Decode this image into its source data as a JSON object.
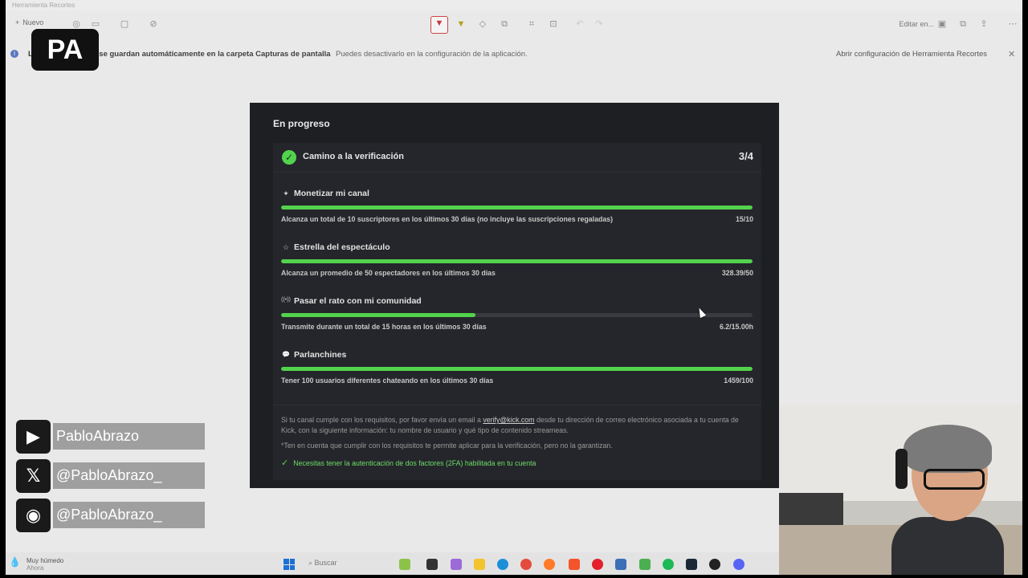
{
  "window": {
    "title": "Herramienta Recortes",
    "new_label": "Nuevo",
    "edit_in_label": "Editar en..."
  },
  "infobar": {
    "message_prefix": "L",
    "message": "alla se guardan automáticamente en la carpeta Capturas de pantalla",
    "sub": "Puedes desactivarlo en la configuración de la aplicación.",
    "link": "Abrir configuración de Herramienta Recortes",
    "close": "✕"
  },
  "logo": {
    "text": "PA"
  },
  "panel": {
    "title": "En progreso",
    "card_title": "Camino a la verificación",
    "card_count": "3/4",
    "requirements": [
      {
        "icon": "✦",
        "title": "Monetizar mi canal",
        "desc": "Alcanza un total de 10 suscriptores en los últimos 30 días (no incluye las suscripciones regaladas)",
        "value": "15/10",
        "progress": 1.0
      },
      {
        "icon": "☆",
        "title": "Estrella del espectáculo",
        "desc": "Alcanza un promedio de 50 espectadores en los últimos 30 días",
        "value": "328.39/50",
        "progress": 1.0
      },
      {
        "icon": "((•))",
        "title": "Pasar el rato con mi comunidad",
        "desc": "Transmite durante un total de 15 horas en los últimos 30 días",
        "value": "6.2/15.00h",
        "progress": 0.413
      },
      {
        "icon": "💬",
        "title": "Parlanchines",
        "desc": "Tener 100 usuarios diferentes chateando en los últimos 30 días",
        "value": "1459/100",
        "progress": 1.0
      }
    ],
    "note_pre": "Si tu canal cumple con los requisitos, por favor envía un email a",
    "note_email": "verify@kick.com",
    "note_post": "desde tu dirección de correo electrónico asociada a tu cuenta de Kick, con la siguiente información: tu nombre de usuario y qué tipo de contenido streameas.",
    "note2": "*Ten en cuenta que cumplir con los requisitos te permite aplicar para la verificación, pero no la garantizan.",
    "twofa": "Necesitas tener la autenticación de dos factores (2FA) habilitada en tu cuenta"
  },
  "socials": [
    {
      "icon": "youtube-icon",
      "glyph": "▶",
      "handle": "PabloAbrazo"
    },
    {
      "icon": "x-icon",
      "glyph": "𝕏",
      "handle": "@PabloAbrazo_"
    },
    {
      "icon": "discord-icon",
      "glyph": "◉",
      "handle": "@PabloAbrazo_"
    }
  ],
  "taskbar": {
    "weather": "Muy húmedo",
    "weather_sub": "Ahora",
    "search": "Buscar"
  },
  "colors": {
    "accent_green": "#53d34d",
    "panel_bg": "#1e1f23",
    "card_bg": "#25262b"
  }
}
